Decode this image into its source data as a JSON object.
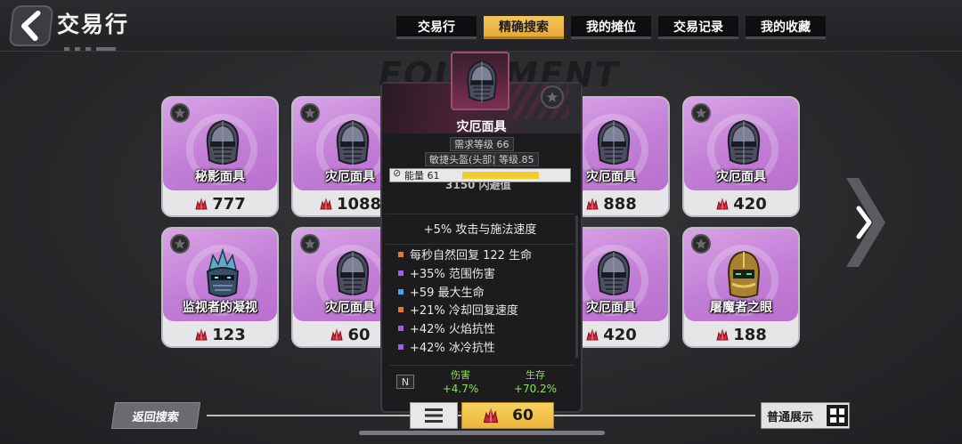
{
  "header": {
    "title": "交易行",
    "tabs": [
      {
        "label": "交易行",
        "active": false
      },
      {
        "label": "精确搜索",
        "active": true
      },
      {
        "label": "我的摊位",
        "active": false
      },
      {
        "label": "交易记录",
        "active": false
      },
      {
        "label": "我的收藏",
        "active": false
      }
    ]
  },
  "background_word": "EQUIPMENT",
  "items": [
    {
      "name": "秘影面具",
      "price": "777"
    },
    {
      "name": "灾厄面具",
      "price": "1088"
    },
    {
      "name": "灾厄面具",
      "price": "888"
    },
    {
      "name": "灾厄面具",
      "price": "420"
    },
    {
      "name": "监视者的凝视",
      "price": "123"
    },
    {
      "name": "灾厄面具",
      "price": "60"
    },
    {
      "name": "灾厄面具",
      "price": "420"
    },
    {
      "name": "屠魔者之眼",
      "price": "188"
    }
  ],
  "tooltip": {
    "name": "灾厄面具",
    "required_level": "需求等级 66",
    "item_type": "敏捷头盔(头部)",
    "item_level": "等级.85",
    "energy": "能量 61",
    "energy_fill": 0.72,
    "cut_line": "3150 闪避值",
    "main_affix": "+5% 攻击与施法速度",
    "affixes": [
      {
        "text": "每秒自然回复 122 生命",
        "color": "#e8782a"
      },
      {
        "text": "+35% 范围伤害",
        "color": "#a45ee6"
      },
      {
        "text": "+59 最大生命",
        "color": "#4aa3e8"
      },
      {
        "text": "+21% 冷却回复速度",
        "color": "#e8782a"
      },
      {
        "text": "+42% 火焰抗性",
        "color": "#a45ee6"
      },
      {
        "text": "+42% 冰冷抗性",
        "color": "#a45ee6"
      }
    ],
    "badge": "N",
    "stats": [
      {
        "label": "伤害",
        "value": "+4.7%"
      },
      {
        "label": "生存",
        "value": "+70.2%"
      }
    ]
  },
  "footer": {
    "return_label": "返回搜索",
    "price_value": "60",
    "mode_label": "普通展示"
  },
  "colors": {
    "accent": "#f2c04e",
    "card_art": "#c27ed6",
    "energy_bar": "#f1cd2d",
    "stat_green": "#8fe05a"
  }
}
